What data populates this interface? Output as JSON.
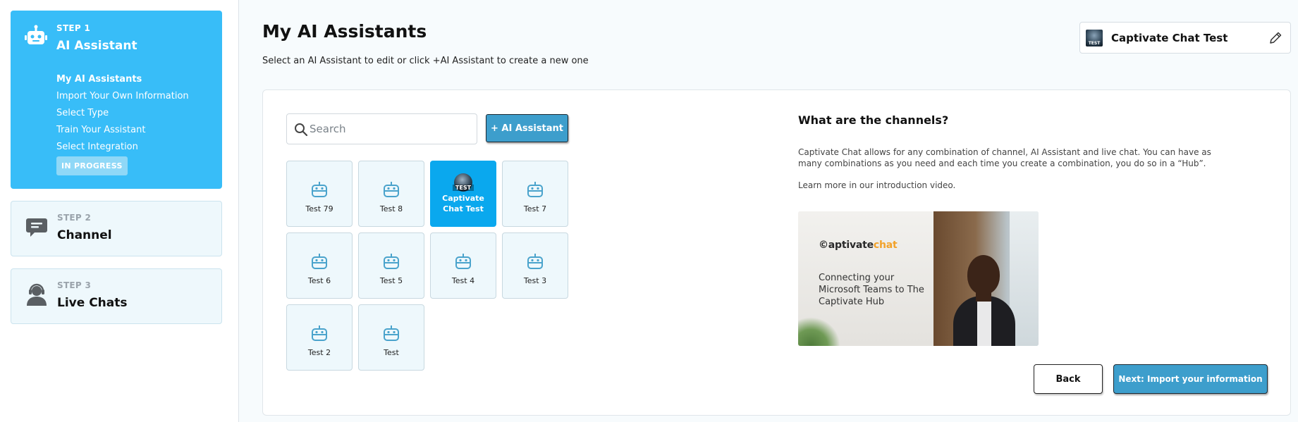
{
  "sidebar": {
    "steps": [
      {
        "kicker": "STEP 1",
        "title": "AI Assistant",
        "icon": "robot-icon",
        "substeps": [
          {
            "label": "My AI Assistants"
          },
          {
            "label": "Import Your Own Information"
          },
          {
            "label": "Select Type"
          },
          {
            "label": "Train Your Assistant"
          },
          {
            "label": "Select Integration"
          }
        ],
        "badge": "IN PROGRESS"
      },
      {
        "kicker": "STEP 2",
        "title": "Channel",
        "icon": "chat-bubble-icon"
      },
      {
        "kicker": "STEP 3",
        "title": "Live Chats",
        "icon": "headset-agent-icon"
      }
    ]
  },
  "header": {
    "title": "My AI Assistants",
    "subtitle": "Select an AI Assistant to edit or click +AI Assistant to create a new one",
    "hub": {
      "name": "Captivate Chat Test",
      "avatar_text": "TEST"
    }
  },
  "search": {
    "placeholder": "Search",
    "value": ""
  },
  "add_button": "+ AI Assistant",
  "assistants": [
    {
      "label": "Test 79"
    },
    {
      "label": "Test 8"
    },
    {
      "label": "Captivate Chat Test",
      "avatar_text": "TEST",
      "selected": true
    },
    {
      "label": "Test 7"
    },
    {
      "label": "Test 6"
    },
    {
      "label": "Test 5"
    },
    {
      "label": "Test 4"
    },
    {
      "label": "Test 3"
    },
    {
      "label": "Test 2"
    },
    {
      "label": "Test"
    }
  ],
  "channels": {
    "title": "What are the channels?",
    "text": "Captivate Chat allows for any combination of channel, AI Assistant and live chat. You can have as many combinations as you need and each time you create a combination, you do so in a “Hub”.",
    "link_text": "Learn more in our introduction video."
  },
  "video": {
    "brand_prefix": "©aptivate",
    "brand_accent": "chat",
    "caption": "Connecting your Microsoft Teams to The Captivate Hub"
  },
  "buttons": {
    "back": "Back",
    "next": "Next: Import your information"
  },
  "colors": {
    "accent": "#38bdf8",
    "selected_tile": "#0aa8ee",
    "primary_button": "#3d9ecc",
    "brand_accent": "#f2a22a"
  }
}
